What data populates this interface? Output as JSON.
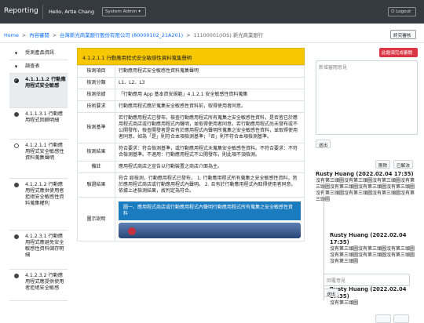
{
  "navbar": {
    "brand": "Reporting",
    "greeting": "Hello, Artie Chang",
    "system_admin": "System Admin ▾",
    "logout": "⏻ Logout"
  },
  "breadcrumb": {
    "home": "Home",
    "item1": "內容審閱",
    "item2": "台灣新光商業銀行股份有限公司 (80000102_21A201)",
    "item3": "11100001(iOS) 新光商業銀行",
    "back": "終究審核"
  },
  "sidebar": {
    "items": [
      {
        "label": "受測產品資訊",
        "icon": "expand-arrow-icon"
      },
      {
        "label": "調查表",
        "icon": "expand-arrow-icon"
      },
      {
        "label": "4.1.1.1.2 行動應用程式安全敏感",
        "icon": "check-icon",
        "active": true
      },
      {
        "label": "4.1.1.3.1 行動應用程式回饋明細",
        "icon": "dot-icon"
      },
      {
        "label": "4.1.2.1.1 行動應用程式安全敏感性資料蒐集聲明",
        "icon": "ring-icon"
      },
      {
        "label": "4.1.2.1.2 行動應用程式應供使用者拒絕安全敏感性資料蒐集權利",
        "icon": "dot-icon"
      },
      {
        "label": "4.1.2.3.1 行動應用程式應避免安全敏感性資料儲存明細",
        "icon": "dot-icon"
      },
      {
        "label": "4.1.2.3.2 行動應用程式應提供使用者拒絕安全敏感",
        "icon": "dot-icon"
      }
    ]
  },
  "main": {
    "title": "4.1.2.1.1 行動應用程式安全敏感性資料蒐集聲明",
    "rows": [
      {
        "label": "檢測項目",
        "value": "行動應用程式安全敏感性資料蒐集聲明"
      },
      {
        "label": "檢測分類",
        "value": "L1、L2、L3"
      },
      {
        "label": "檢測依據",
        "value": "「行動應用 App 基本資安規範」4.1.2.1 安全敏感性資料蒐集"
      },
      {
        "label": "技術要求",
        "value": "行動應用程式應於蒐集安全敏感性資料前，取得使用者同意。"
      },
      {
        "label": "檢測基準",
        "value": "若行動應用程式已發布，檢查行動應用程式所有蒐集之安全敏感性資料，是否皆已於應用程式商店或行動應用程式內聲明，並取得使用者同意。若行動應用程式尚未發布或不公開發布，檢查開發者是否有於應用程式內聲明所蒐集之安全敏感性資料，並取得使用者同意。如為「是」則符合本項檢測基準；「否」則不符合本項檢測基準。"
      },
      {
        "label": "檢測結果",
        "value": "符合要求：符合檢測基準，或行動應用程式未蒐集安全敏感性資料。不符合要求：不符合檢測基準。不適用：行動應用程式不公開發布，則此項不須檢測。"
      },
      {
        "label": "備註",
        "value": "應用程式商店之宣告以行動裝置之商店介面為主。"
      },
      {
        "label": "驗證結果",
        "value": "符合 經檢測，行動應用程式已發布， 1. 行動應用程式所有蒐集之安全敏感性資料，皆於應用程式商店或行動應用程式內聲明。 2. 且有於行動應用程式內取得使用者同意。 依據上述檢測結果，故判定為符合。"
      },
      {
        "label": "圖示說明",
        "value": ""
      }
    ],
    "figure_caption": "圖一、應用程式商店或行動應用程式內聲明行動應用程式所有蒐集之安全敏感性資料"
  },
  "right_panel": {
    "add_comment_button": "此題須完成審閱",
    "comment_placeholder": "新增審閱意見",
    "send_button": "送出",
    "delete_button": "刪除",
    "resolved_button": "已解決",
    "comments": [
      {
        "author": "Rusty Huang (2022.02.04 17:35)",
        "body": "沒有第三頭圖沒有第三頭圖沒有第三頭圖沒有第三頭圖沒有第三頭圖沒有第三頭圖沒有第三頭圖沒有第三頭圖沒有第三頭圖沒有第三頭圖沒有第三頭圖"
      },
      {
        "author": "Rusty Huang (2022.02.04 17:35)",
        "body": "沒有第三頭圖沒有第三頭圖沒有第三頭圖沒有第三頭圖沒有第三頭圖沒有第三頭圖沒有第三頭圖"
      },
      {
        "author": "Rusty Huang (2022.02.04 17:35)",
        "body": "沒有第三頭圖"
      }
    ],
    "reply_placeholder": "回覆意見",
    "reply_send": "送出"
  }
}
